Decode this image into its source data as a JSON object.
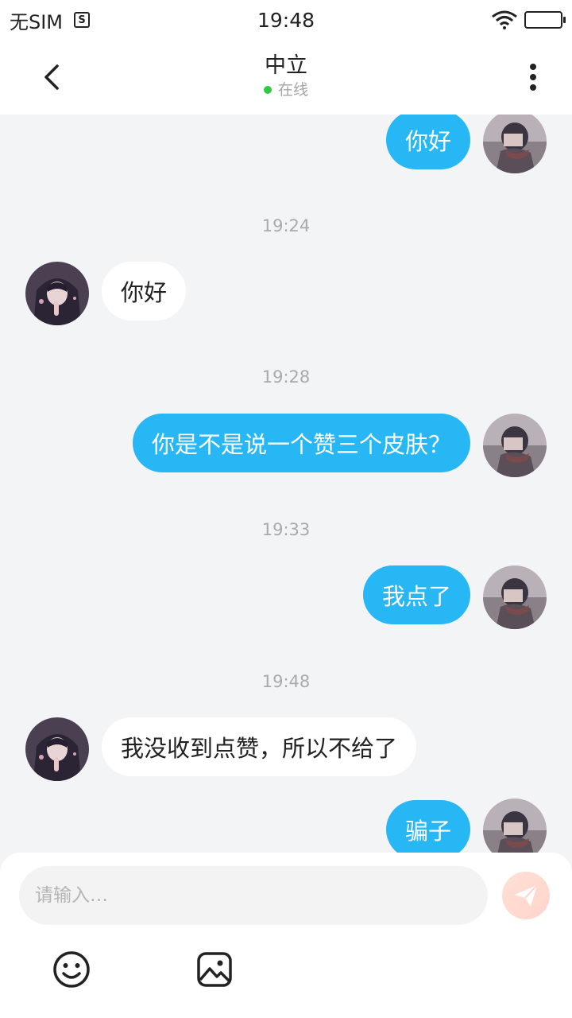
{
  "status_bar": {
    "carrier": "无SIM",
    "sim_icon_text": "S",
    "time": "19:48"
  },
  "header": {
    "title": "中立",
    "status": "在线"
  },
  "messages": [
    {
      "text": "你好",
      "direction": "outgoing"
    },
    {
      "timestamp": "19:24"
    },
    {
      "text": "你好",
      "direction": "incoming"
    },
    {
      "timestamp": "19:28"
    },
    {
      "text": "你是不是说一个赞三个皮肤？",
      "direction": "outgoing"
    },
    {
      "timestamp": "19:33"
    },
    {
      "text": "我点了",
      "direction": "outgoing"
    },
    {
      "timestamp": "19:48"
    },
    {
      "text": "我没收到点赞，所以不给了",
      "direction": "incoming"
    },
    {
      "text": "骗子",
      "direction": "outgoing"
    }
  ],
  "composer": {
    "placeholder": "请输入…",
    "value": ""
  },
  "icons": {
    "back": "chevron-left-icon",
    "more": "vertical-dots-icon",
    "send": "paper-plane-icon",
    "emoji": "smiley-icon",
    "image": "image-icon"
  },
  "colors": {
    "outgoing_bubble": "#27b7f5",
    "incoming_bubble": "#ffffff",
    "online": "#2ec946",
    "background": "#f3f4f6"
  }
}
